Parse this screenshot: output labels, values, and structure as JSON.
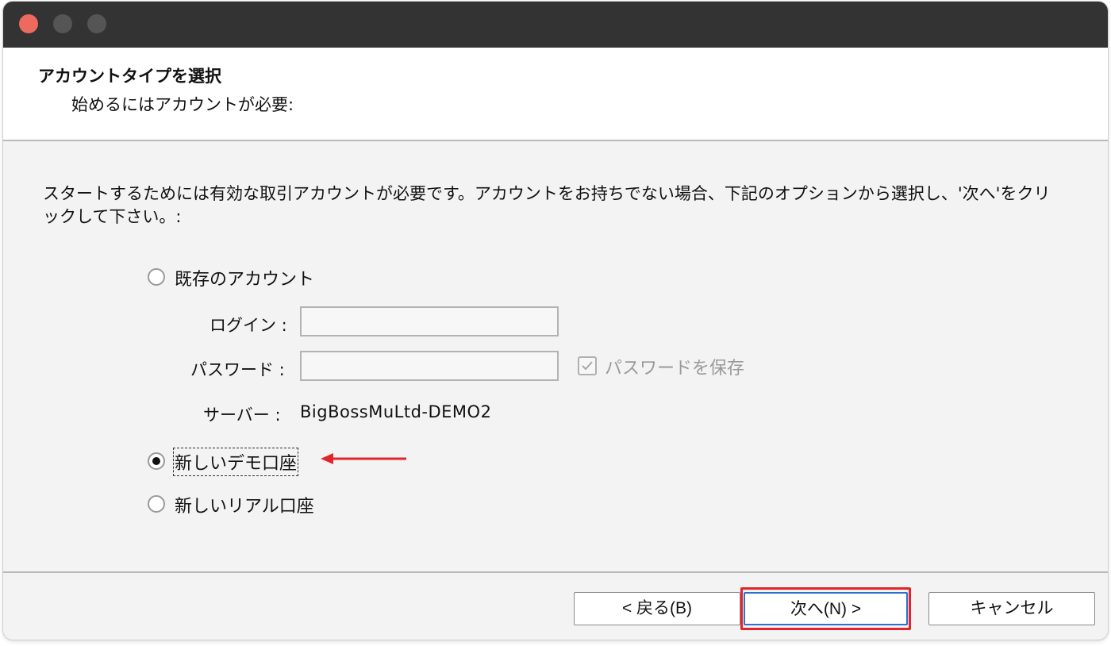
{
  "window": {
    "controls": [
      "close",
      "minimize",
      "maximize"
    ],
    "colors": {
      "titlebar": "#333333",
      "close": "#ed6a5e",
      "inactive": "#555555"
    }
  },
  "header": {
    "title": "アカウントタイプを選択",
    "subtitle": "始めるにはアカウントが必要:"
  },
  "description": "スタートするためには有効な取引アカウントが必要です。アカウントをお持ちでない場合、下記のオプションから選択し、'次へ'をクリックして下さい。:",
  "options": {
    "existing_account": {
      "label": "既存のアカウント",
      "selected": false
    },
    "login": {
      "label": "ログイン :",
      "value": ""
    },
    "password": {
      "label": "パスワード :",
      "value": ""
    },
    "save_password": {
      "label": "パスワードを保存",
      "checked": true,
      "disabled": true
    },
    "server": {
      "label": "サーバー :",
      "value": "BigBossMuLtd-DEMO2"
    },
    "new_demo": {
      "label": "新しいデモ口座",
      "selected": true
    },
    "new_real": {
      "label": "新しいリアル口座",
      "selected": false
    }
  },
  "annotation": {
    "arrow_color": "#e0262b",
    "highlight_color": "#e0262b"
  },
  "buttons": {
    "back": "< 戻る(B)",
    "next": "次へ(N) >",
    "cancel": "キャンセル"
  }
}
